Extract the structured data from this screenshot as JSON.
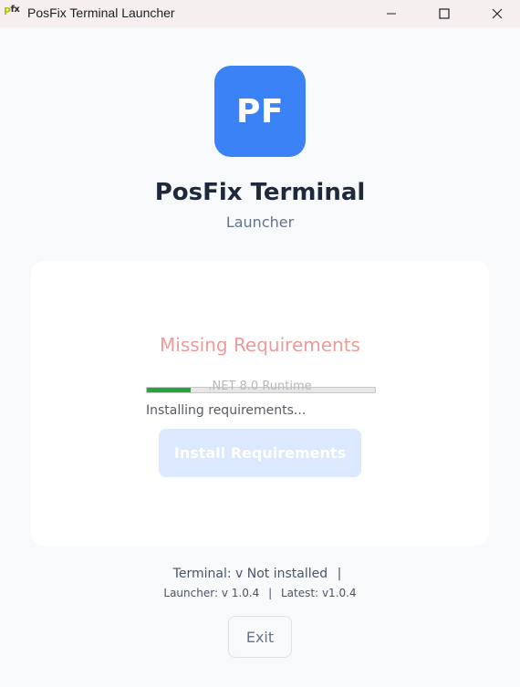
{
  "window": {
    "title": "PosFix Terminal Launcher",
    "icon_p": "P",
    "icon_fx": "fx",
    "minimize_icon": "minimize-icon",
    "maximize_icon": "maximize-icon",
    "close_icon": "close-icon"
  },
  "header": {
    "logo_text": "PF",
    "app_name": "PosFix Terminal",
    "subtitle": "Launcher"
  },
  "status": {
    "title": "Missing Requirements",
    "progress_label": ".NET 8.0 Runtime",
    "progress_fraction": 0.19,
    "detail": "Installing requirements...",
    "install_button": "Install Requirements"
  },
  "footer": {
    "terminal_label": "Terminal:",
    "terminal_version": "v Not installed",
    "separator": "|",
    "launcher_label": "Launcher:",
    "launcher_version": "v 1.0.4",
    "latest_label": "Latest:",
    "latest_version": "v1.0.4",
    "exit_button": "Exit"
  },
  "colors": {
    "accent": "#3b82f6",
    "error": "#ef9a9a",
    "progress": "#22a63c"
  }
}
